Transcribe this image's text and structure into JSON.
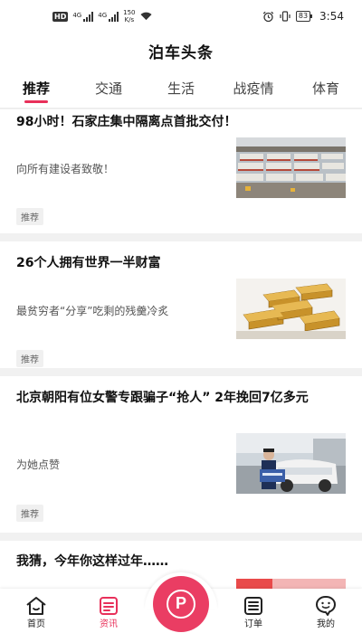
{
  "status_bar": {
    "hd_badge": "HD",
    "signal_1_tag": "4G",
    "signal_2_tag": "4G",
    "speed_value": "150",
    "speed_unit": "K/s",
    "battery": "83",
    "time": "3:54"
  },
  "header": {
    "title": "泊车头条"
  },
  "tabs": [
    {
      "label": "推荐",
      "active": true
    },
    {
      "label": "交通",
      "active": false
    },
    {
      "label": "生活",
      "active": false
    },
    {
      "label": "战疫情",
      "active": false
    },
    {
      "label": "体育",
      "active": false
    }
  ],
  "articles": [
    {
      "title": "98小时！石家庄集中隔离点首批交付！",
      "subtitle": "向所有建设者致敬！",
      "tag": "推荐",
      "image": "construction-site-photo"
    },
    {
      "title": "26个人拥有世界一半财富",
      "subtitle": "最贫穷者“分享”吃剩的残羹冷炙",
      "tag": "推荐",
      "image": "gold-bars-photo"
    },
    {
      "title": "北京朝阳有位女警专跟骗子“抢人” 2年挽回7亿多元",
      "subtitle": "为她点赞",
      "tag": "推荐",
      "image": "policewoman-photo"
    },
    {
      "title": "我猜，今年你这样过年……",
      "image": "new-year-photo"
    }
  ],
  "bottom_nav": {
    "home_label": "首页",
    "news_label": "资讯",
    "center_label": "P",
    "orders_label": "订单",
    "mine_label": "我的"
  },
  "colors": {
    "accent": "#e8305a",
    "park_button": "#ea3d63",
    "feed_background": "#f1f1f1"
  }
}
